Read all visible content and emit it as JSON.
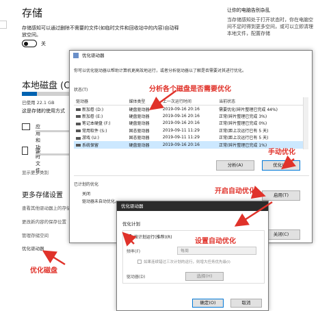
{
  "settings": {
    "storage_title": "存储",
    "storage_desc": "存储感知可以通过删除不需要的文件(如临时文件和回收站中的内容)自动释放空间。",
    "toggle_state": "关",
    "right_title": "让你的电脑告别杂乱",
    "right_desc": "当存储感知处于打开状态时，你在电脑空间不足时得到更多空间，或可以立即清理本地文件，配置存储",
    "local_title": "本地磁盘 (C:)",
    "used_text": "已使用 22.1 GB",
    "used_fraction": 0.3,
    "how_text": "这是存储的使用方式",
    "categories": [
      "应用和功能",
      "临时文件"
    ],
    "show_more": "显示更多类别",
    "more_title": "更多存储设置",
    "links": [
      "查看其他驱动器上的存储使用情况",
      "更改新内容的保存位置",
      "管理存储空间",
      "优化驱动器"
    ]
  },
  "optimize_window": {
    "title": "优化驱动器",
    "desc": "你可以优化驱动器以帮助计算机更高效地运行，或者分析驱动器以了解是否需要对其进行优化。",
    "status_label": "状态(T)",
    "columns": [
      "驱动器",
      "媒体类型",
      "上一次运行时间",
      "当前状态"
    ],
    "rows": [
      [
        "新加卷 (D:)",
        "硬盘驱动器",
        "2019-09-16 20:16",
        "需要优化(碎片整理已完成 44%)"
      ],
      [
        "新加卷 (E:)",
        "硬盘驱动器",
        "2019-09-16 20:16",
        "正常(碎片整理已完成 3%)"
      ],
      [
        "笔记本硬盘 (F:)",
        "硬盘驱动器",
        "2019-09-16 20:16",
        "正常(碎片整理已完成 0%)"
      ],
      [
        "常用软件 (S:)",
        "固态驱动器",
        "2019-09-11 11:29",
        "正常(距上次运行已有 5 天)"
      ],
      [
        "游戏 (U:)",
        "固态驱动器",
        "2019-09-11 11:29",
        "正常(距上次运行已有 5 天)"
      ],
      [
        "系统保留",
        "硬盘驱动器",
        "2019-09-16 20:16",
        "正常(碎片整理已完成 1%)"
      ]
    ],
    "analyze_label": "分析(A)",
    "optimize_label": "优化(O)",
    "scheduled_label": "已计划的优化",
    "off_label": "关闭",
    "auto_desc": "驱动器未自动优化。",
    "enable_label": "启用(T)",
    "close_label": "关闭(C)"
  },
  "schedule_dialog": {
    "title": "优化驱动器",
    "plan_title": "优化计划",
    "run_on_schedule": "按计划运行(推荐)(R)",
    "frequency_label": "频率(F)",
    "frequency_value": "每周",
    "notify_text": "如果连续错过三次计划的运行，则增大任务优先级(I)",
    "drives_label": "驱动器(D)",
    "choose_label": "选择(H)",
    "ok_label": "确定(O)",
    "cancel_label": "取消"
  },
  "annotations": {
    "analyze_note": "分析各个磁盘是否需要优化",
    "manual_note": "手动优化",
    "auto_note": "开启自动优化",
    "schedule_note": "设置自动优化",
    "optimize_disk_note": "优化磁盘",
    "color": "#e0322a"
  }
}
